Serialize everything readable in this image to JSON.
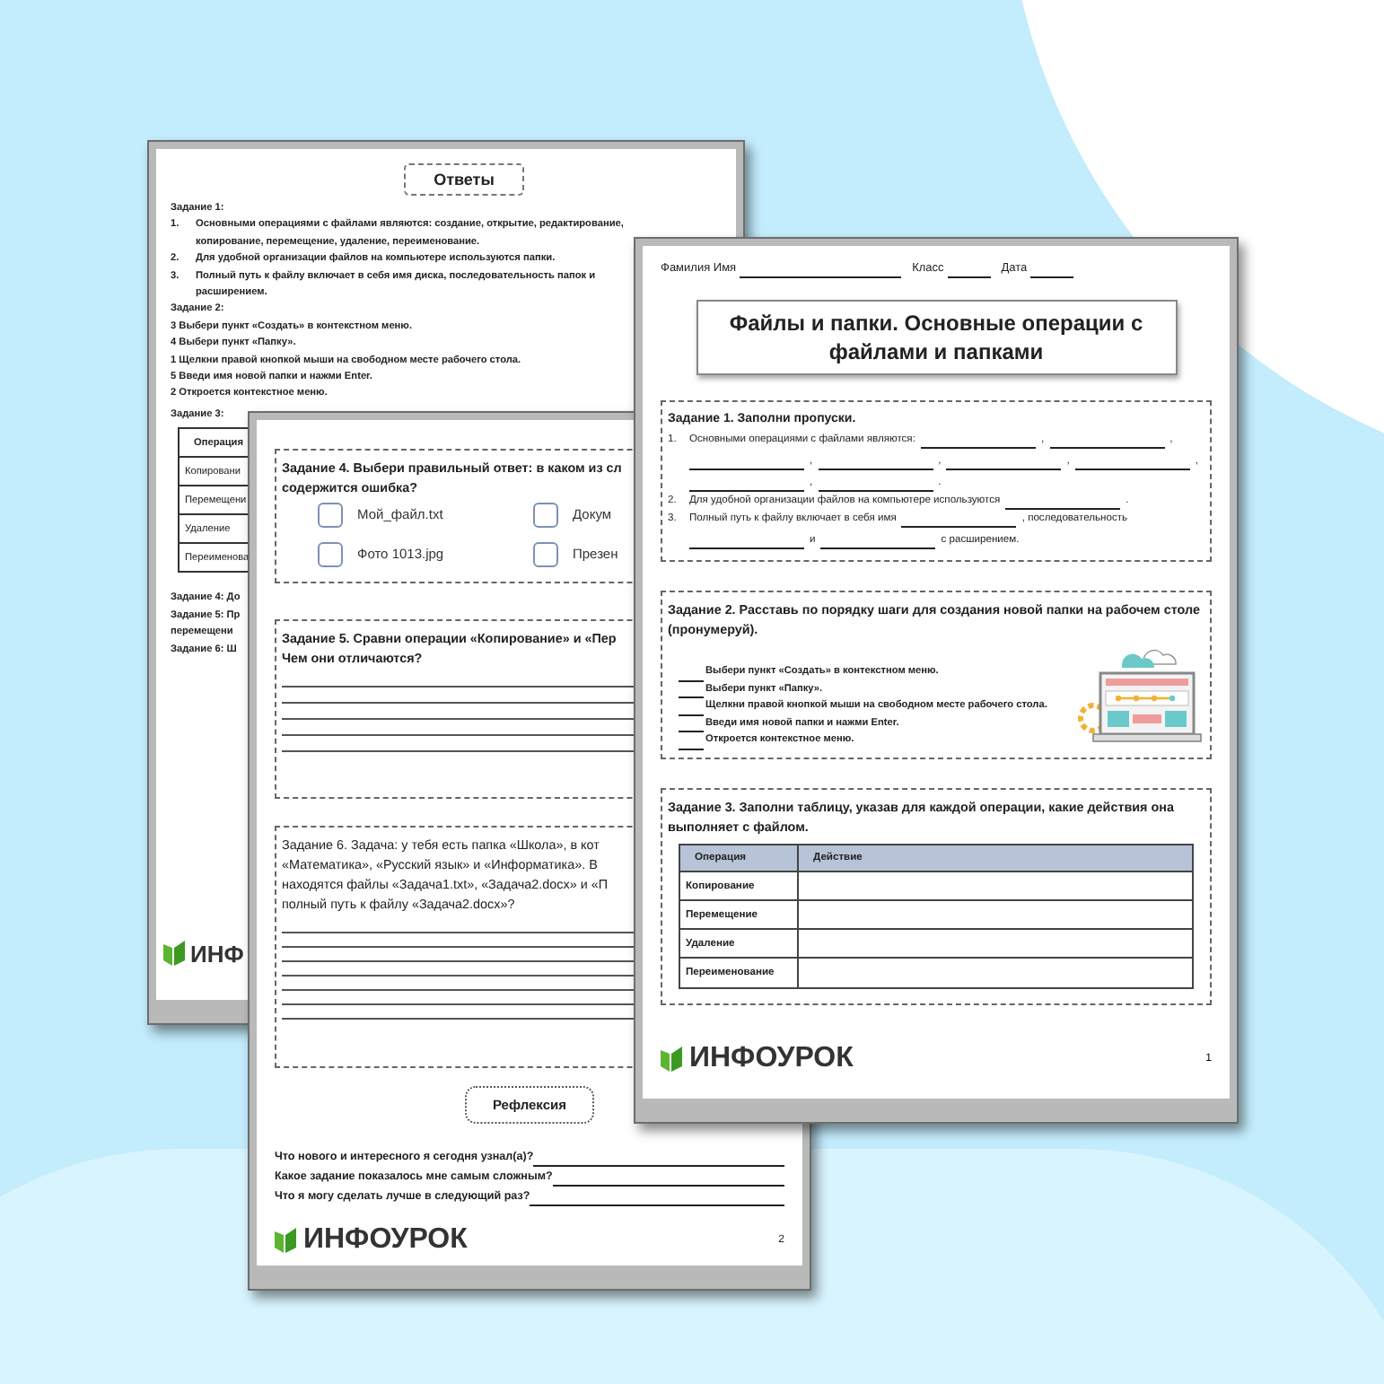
{
  "answers_page": {
    "title": "Ответы",
    "task1": {
      "heading": "Задание 1:",
      "items": [
        {
          "number": "1.",
          "lines": [
            "Основными операциями с файлами являются: создание, открытие, редактирование,",
            "копирование, перемещение, удаление, переименование."
          ]
        },
        {
          "number": "2.",
          "lines": [
            "Для удобной организации файлов на компьютере используются папки."
          ]
        },
        {
          "number": "3.",
          "lines": [
            "Полный путь к файлу включает в себя имя диска, последовательность папок и",
            "расширением."
          ]
        }
      ]
    },
    "task2": {
      "heading": "Задание 2:",
      "lines": [
        "3 Выбери пункт «Создать» в контекстном меню.",
        "4 Выбери пункт «Папку».",
        "1 Щелкни правой кнопкой мыши на свободном месте рабочего стола.",
        "5 Введи имя новой папки и нажми Enter.",
        "2 Откроется контекстное меню."
      ]
    },
    "task3": {
      "heading": "Задание 3:",
      "column": "Операция",
      "rows": [
        "Копировани",
        "Перемещени",
        "Удаление",
        "Переименова"
      ]
    },
    "notes": [
      "Задание 4: До",
      "Задание 5: Пр",
      "перемещени",
      "Задание 6: Ш"
    ],
    "logo": "ИНФ"
  },
  "page_2": {
    "task4": {
      "lines": [
        "Задание 4. Выбери правильный ответ: в каком из сл",
        "содержится ошибка?"
      ],
      "options": [
        {
          "label": "Мой_файл.txt",
          "checked": false
        },
        {
          "label": "Докум",
          "checked": false
        },
        {
          "label": "Фото 1013.jpg",
          "checked": false
        },
        {
          "label": "Презен",
          "checked": false
        }
      ]
    },
    "task5": {
      "lines": [
        "Задание 5. Сравни операции «Копирование» и «Пер",
        "Чем они отличаются?"
      ]
    },
    "task6": {
      "lines": [
        "Задание 6. Задача: у тебя есть папка «Школа», в кот",
        "«Математика», «Русский язык» и «Информатика». В",
        "находятся файлы «Задача1.txt», «Задача2.docx» и «П",
        "полный путь к файлу «Задача2.docx»?"
      ]
    },
    "reflection": {
      "title": "Рефлексия",
      "questions": [
        "Что нового и интересного я сегодня узнал(а)?",
        "Какое задание показалось мне самым сложным?",
        "Что я могу сделать лучше в следующий раз?"
      ]
    },
    "logo": "ИНФОУРОК",
    "page_number": "2"
  },
  "page_1": {
    "header_fields": [
      "Фамилия Имя",
      "Класс",
      "Дата"
    ],
    "title": "Файлы и папки. Основные операции с файлами и папками",
    "task1": {
      "heading": "Задание 1. Заполни пропуски.",
      "items": [
        {
          "number": "1.",
          "parts": [
            {
              "kind": "text",
              "text": "Основными операциями с файлами являются:"
            },
            {
              "kind": "blank"
            },
            {
              "kind": "text",
              "text": ","
            },
            {
              "kind": "blank"
            },
            {
              "kind": "text",
              "text": ","
            },
            {
              "kind": "blank"
            },
            {
              "kind": "text",
              "text": ","
            },
            {
              "kind": "blank"
            },
            {
              "kind": "text",
              "text": ","
            },
            {
              "kind": "blank"
            },
            {
              "kind": "text",
              "text": ","
            },
            {
              "kind": "blank"
            },
            {
              "kind": "text",
              "text": ","
            },
            {
              "kind": "blank"
            },
            {
              "kind": "text",
              "text": ","
            },
            {
              "kind": "blank"
            },
            {
              "kind": "text",
              "text": "."
            }
          ]
        },
        {
          "number": "2.",
          "parts": [
            {
              "kind": "text",
              "text": "Для удобной организации файлов на компьютере используются"
            },
            {
              "kind": "blank"
            },
            {
              "kind": "text",
              "text": "."
            }
          ]
        },
        {
          "number": "3.",
          "parts": [
            {
              "kind": "text",
              "text": "Полный путь к файлу включает в себя имя"
            },
            {
              "kind": "blank"
            },
            {
              "kind": "text",
              "text": ", последовательность"
            },
            {
              "kind": "blank"
            },
            {
              "kind": "text",
              "text": "и"
            },
            {
              "kind": "blank"
            },
            {
              "kind": "text",
              "text": "с расширением."
            }
          ]
        }
      ]
    },
    "task2": {
      "heading": "Задание 2. Расставь по порядку шаги для создания новой папки на рабочем столе (пронумеруй).",
      "steps": [
        "Выбери пункт «Создать» в контекстном меню.",
        "Выбери пункт «Папку».",
        "Щелкни правой кнопкой мыши на свободном месте рабочего стола.",
        "Введи имя новой папки и нажми Enter.",
        "Откроется контекстное меню."
      ]
    },
    "task3": {
      "heading": "Задание 3. Заполни таблицу, указав для каждой операции, какие действия она выполняет с файлом.",
      "columns": [
        "Операция",
        "Действие"
      ],
      "rows": [
        "Копирование",
        "Перемещение",
        "Удаление",
        "Переименование"
      ]
    },
    "logo": "ИНФОУРОК",
    "page_number": "1"
  }
}
